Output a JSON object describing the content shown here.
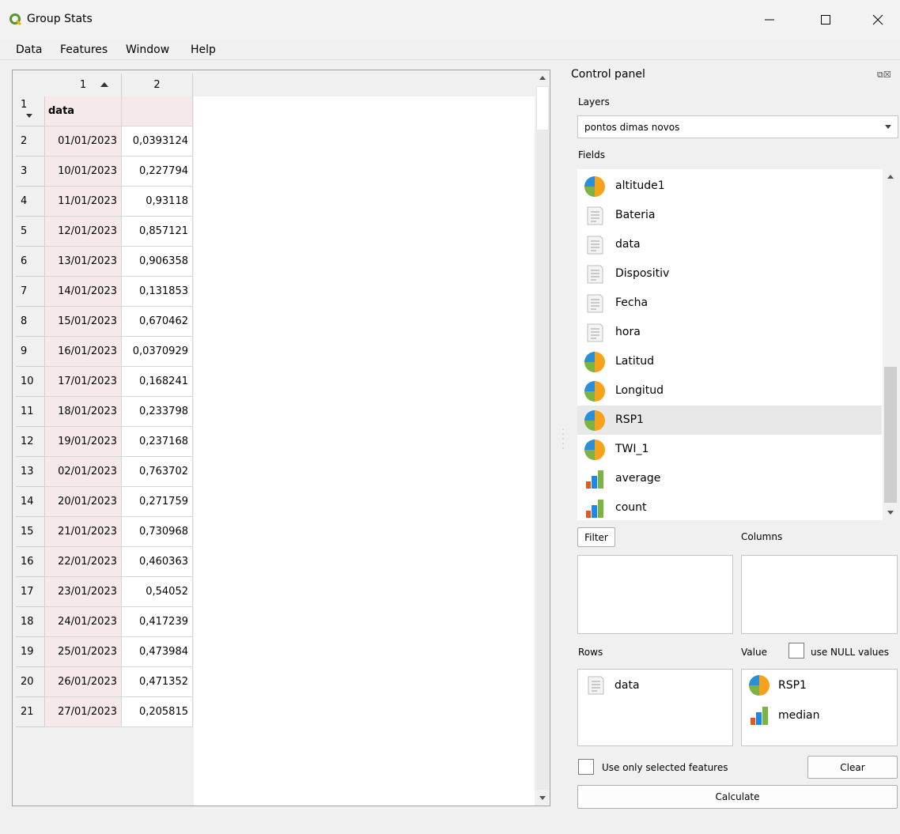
{
  "window": {
    "title": "Group Stats",
    "icons": [
      "qgis-logo-icon",
      "minimize-icon",
      "maximize-icon",
      "close-icon"
    ]
  },
  "menu": [
    "Data",
    "Features",
    "Window",
    "Help"
  ],
  "table": {
    "col_headers": [
      "1",
      "2"
    ],
    "header_row": {
      "index": "1",
      "label": "data",
      "value": ""
    },
    "rows": [
      {
        "index": "2",
        "date": "01/01/2023",
        "value": "0,0393124"
      },
      {
        "index": "3",
        "date": "10/01/2023",
        "value": "0,227794"
      },
      {
        "index": "4",
        "date": "11/01/2023",
        "value": "0,93118"
      },
      {
        "index": "5",
        "date": "12/01/2023",
        "value": "0,857121"
      },
      {
        "index": "6",
        "date": "13/01/2023",
        "value": "0,906358"
      },
      {
        "index": "7",
        "date": "14/01/2023",
        "value": "0,131853"
      },
      {
        "index": "8",
        "date": "15/01/2023",
        "value": "0,670462"
      },
      {
        "index": "9",
        "date": "16/01/2023",
        "value": "0,0370929"
      },
      {
        "index": "10",
        "date": "17/01/2023",
        "value": "0,168241"
      },
      {
        "index": "11",
        "date": "18/01/2023",
        "value": "0,233798"
      },
      {
        "index": "12",
        "date": "19/01/2023",
        "value": "0,237168"
      },
      {
        "index": "13",
        "date": "02/01/2023",
        "value": "0,763702"
      },
      {
        "index": "14",
        "date": "20/01/2023",
        "value": "0,271759"
      },
      {
        "index": "15",
        "date": "21/01/2023",
        "value": "0,730968"
      },
      {
        "index": "16",
        "date": "22/01/2023",
        "value": "0,460363"
      },
      {
        "index": "17",
        "date": "23/01/2023",
        "value": "0,54052"
      },
      {
        "index": "18",
        "date": "24/01/2023",
        "value": "0,417239"
      },
      {
        "index": "19",
        "date": "25/01/2023",
        "value": "0,473984"
      },
      {
        "index": "20",
        "date": "26/01/2023",
        "value": "0,471352"
      },
      {
        "index": "21",
        "date": "27/01/2023",
        "value": "0,205815"
      }
    ]
  },
  "panel": {
    "title": "Control panel",
    "layers_label": "Layers",
    "layer_selected": "pontos dimas novos",
    "fields_label": "Fields",
    "fields": [
      {
        "name": "altitude1",
        "type": "numeric",
        "icon": "numeric-field-icon"
      },
      {
        "name": "Bateria",
        "type": "text",
        "icon": "text-field-icon"
      },
      {
        "name": "data",
        "type": "text",
        "icon": "text-field-icon"
      },
      {
        "name": "Dispositiv",
        "type": "text",
        "icon": "text-field-icon"
      },
      {
        "name": "Fecha",
        "type": "text",
        "icon": "text-field-icon"
      },
      {
        "name": "hora",
        "type": "text",
        "icon": "text-field-icon"
      },
      {
        "name": "Latitud",
        "type": "numeric",
        "icon": "numeric-field-icon"
      },
      {
        "name": "Longitud",
        "type": "numeric",
        "icon": "numeric-field-icon"
      },
      {
        "name": "RSP1",
        "type": "numeric",
        "icon": "numeric-field-icon",
        "selected": true
      },
      {
        "name": "TWI_1",
        "type": "numeric",
        "icon": "numeric-field-icon"
      },
      {
        "name": "average",
        "type": "stat",
        "icon": "statistic-icon"
      },
      {
        "name": "count",
        "type": "stat",
        "icon": "statistic-icon"
      }
    ],
    "filter_button": "Filter",
    "columns_label": "Columns",
    "rows_label": "Rows",
    "value_label": "Value",
    "use_null_label": "use NULL values",
    "rows_items": [
      {
        "name": "data",
        "icon": "text-field-icon"
      }
    ],
    "value_items": [
      {
        "name": "RSP1",
        "icon": "numeric-field-icon"
      },
      {
        "name": "median",
        "icon": "statistic-icon"
      }
    ],
    "use_selected_label": "Use only selected features",
    "clear_button": "Clear",
    "calculate_button": "Calculate"
  },
  "colors": {
    "header_pink": "#f5e9e9",
    "selection_gray": "#e8e8e8",
    "numeric_blue": "#2a8fd6",
    "numeric_orange": "#f7a21b"
  }
}
